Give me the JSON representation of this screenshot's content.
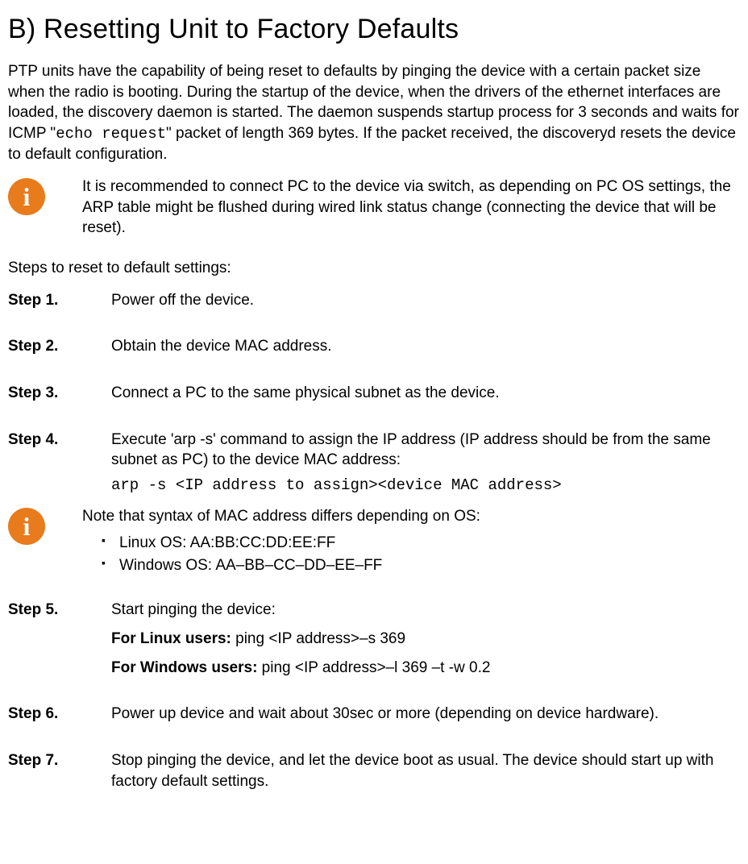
{
  "title": "B) Resetting Unit to Factory Defaults",
  "intro": {
    "pre": "PTP units have the capability of being reset to defaults by pinging the device with a certain packet size when the radio is booting. During the startup of the device, when the drivers of the ethernet interfaces are loaded, the discovery daemon is started. The daemon suspends startup process for 3 seconds and waits for ICMP \"",
    "code": "echo request",
    "post": "\" packet of length 369 bytes. If the packet received, the discoveryd resets the device to default configuration."
  },
  "info1": "It is recommended to connect PC to the device via switch, as depending on PC OS settings, the ARP table might be flushed during wired link status change (connecting the device that will be reset).",
  "steps_intro": "Steps to reset to default settings:",
  "steps": [
    {
      "label": "Step 1.",
      "text": "Power off the device."
    },
    {
      "label": "Step 2.",
      "text": "Obtain the device MAC address."
    },
    {
      "label": "Step 3.",
      "text": "Connect a PC to the same physical subnet as the device."
    },
    {
      "label": "Step 4.",
      "text": "Execute 'arp -s' command to assign the IP address (IP address should be from the same subnet as PC) to the device MAC address:",
      "code": "arp -s <IP address to assign><device MAC address>"
    },
    {
      "label": "Step 5.",
      "text": "Start pinging the device:",
      "linux_label": "For Linux users:",
      "linux_cmd": " ping <IP address>–s 369",
      "win_label": "For Windows users:",
      "win_cmd": " ping <IP address>–l 369 –t -w 0.2"
    },
    {
      "label": "Step 6.",
      "text": "Power up device and wait about 30sec or more (depending on device hardware)."
    },
    {
      "label": "Step 7.",
      "text": "Stop pinging the device, and let the device boot as usual. The device should start up with factory default settings."
    }
  ],
  "info2": {
    "intro": "Note that syntax of MAC address differs depending on OS:",
    "bullets": [
      "Linux OS: AA:BB:CC:DD:EE:FF",
      "Windows OS: AA–BB–CC–DD–EE–FF"
    ]
  }
}
